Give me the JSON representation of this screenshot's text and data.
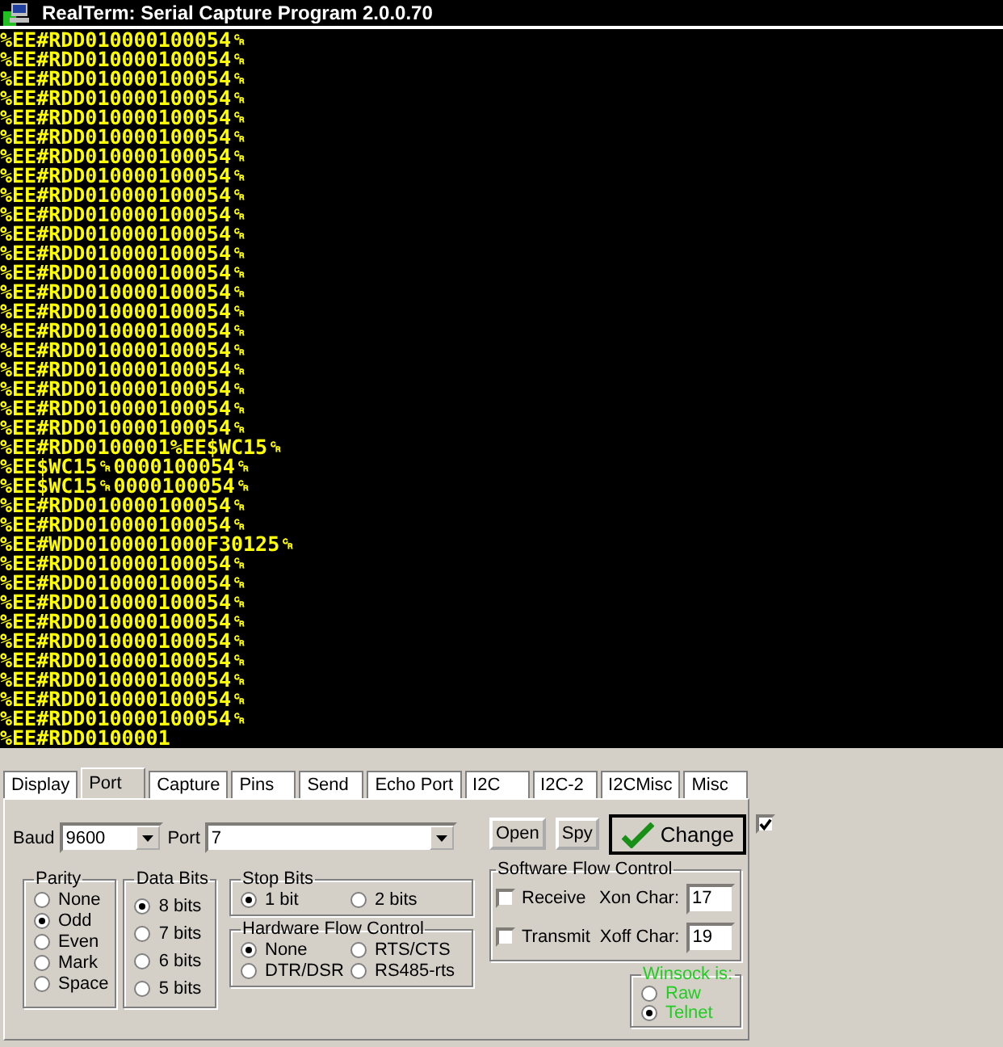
{
  "window": {
    "title": "RealTerm: Serial Capture Program 2.0.0.70"
  },
  "terminal": {
    "lines": [
      "%EE#RDD010000100054␍",
      "%EE#RDD010000100054␍",
      "%EE#RDD010000100054␍",
      "%EE#RDD010000100054␍",
      "%EE#RDD010000100054␍",
      "%EE#RDD010000100054␍",
      "%EE#RDD010000100054␍",
      "%EE#RDD010000100054␍",
      "%EE#RDD010000100054␍",
      "%EE#RDD010000100054␍",
      "%EE#RDD010000100054␍",
      "%EE#RDD010000100054␍",
      "%EE#RDD010000100054␍",
      "%EE#RDD010000100054␍",
      "%EE#RDD010000100054␍",
      "%EE#RDD010000100054␍",
      "%EE#RDD010000100054␍",
      "%EE#RDD010000100054␍",
      "%EE#RDD010000100054␍",
      "%EE#RDD010000100054␍",
      "%EE#RDD010000100054␍",
      "%EE#RDD0100001%EE$WC15␍",
      "%EE$WC15␍0000100054␍",
      "%EE$WC15␍0000100054␍",
      "%EE#RDD010000100054␍",
      "%EE#RDD010000100054␍",
      "%EE#WDD0100001000F30125␍",
      "%EE#RDD010000100054␍",
      "%EE#RDD010000100054␍",
      "%EE#RDD010000100054␍",
      "%EE#RDD010000100054␍",
      "%EE#RDD010000100054␍",
      "%EE#RDD010000100054␍",
      "%EE#RDD010000100054␍",
      "%EE#RDD010000100054␍",
      "%EE#RDD010000100054␍",
      "%EE#RDD0100001"
    ]
  },
  "tabs": [
    {
      "label": "Display",
      "selected": false
    },
    {
      "label": "Port",
      "selected": true
    },
    {
      "label": "Capture",
      "selected": false
    },
    {
      "label": "Pins",
      "selected": false
    },
    {
      "label": "Send",
      "selected": false
    },
    {
      "label": "Echo Port",
      "selected": false
    },
    {
      "label": "I2C",
      "selected": false
    },
    {
      "label": "I2C-2",
      "selected": false
    },
    {
      "label": "I2CMisc",
      "selected": false
    },
    {
      "label": "Misc",
      "selected": false
    }
  ],
  "port": {
    "baud": {
      "label": "Baud",
      "value": "9600"
    },
    "port": {
      "label": "Port",
      "value": "7"
    },
    "buttons": [
      "Open",
      "Spy"
    ],
    "change": {
      "label": "Change",
      "checked": true
    },
    "parity": {
      "title": "Parity",
      "options": [
        {
          "label": "None",
          "selected": false
        },
        {
          "label": "Odd",
          "selected": true
        },
        {
          "label": "Even",
          "selected": false
        },
        {
          "label": "Mark",
          "selected": false
        },
        {
          "label": "Space",
          "selected": false
        }
      ]
    },
    "data_bits": {
      "title": "Data Bits",
      "options": [
        {
          "label": "8 bits",
          "selected": true
        },
        {
          "label": "7 bits",
          "selected": false
        },
        {
          "label": "6 bits",
          "selected": false
        },
        {
          "label": "5 bits",
          "selected": false
        }
      ]
    },
    "stop_bits": {
      "title": "Stop Bits",
      "options": [
        {
          "label": "1 bit",
          "selected": true
        },
        {
          "label": "2 bits",
          "selected": false
        }
      ]
    },
    "hardware_flow": {
      "title": "Hardware Flow Control",
      "options": [
        {
          "label": "None",
          "selected": true
        },
        {
          "label": "RTS/CTS",
          "selected": false
        },
        {
          "label": "DTR/DSR",
          "selected": false
        },
        {
          "label": "RS485-rts",
          "selected": false
        }
      ]
    },
    "software_flow": {
      "title": "Software Flow Control",
      "rows": [
        {
          "label": "Receive",
          "checked": false,
          "char_label": "Xon Char:",
          "value": "17"
        },
        {
          "label": "Transmit",
          "checked": false,
          "char_label": "Xoff Char:",
          "value": "19"
        }
      ]
    },
    "winsock": {
      "title": "Winsock is:",
      "options": [
        {
          "label": "Raw",
          "selected": false
        },
        {
          "label": "Telnet",
          "selected": true
        }
      ]
    }
  }
}
